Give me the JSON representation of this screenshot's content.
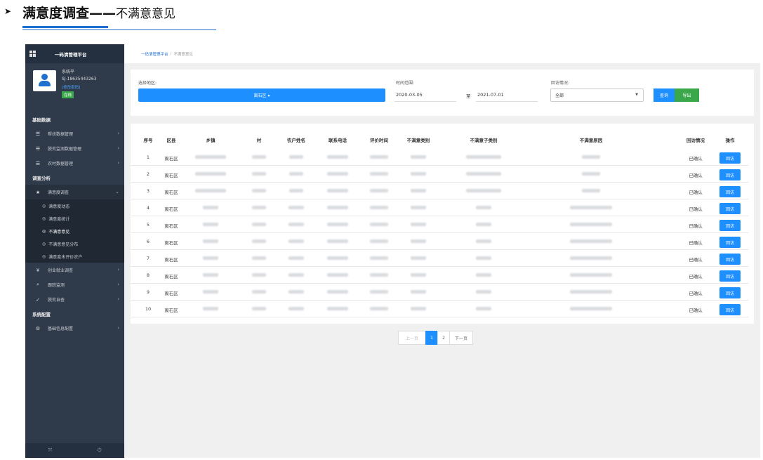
{
  "doc": {
    "title_bold": "满意度调查",
    "title_dash": "——",
    "title_rest": "不满意意见"
  },
  "sidebar": {
    "brand": "一码清管理平台",
    "user": {
      "name": "系统平",
      "phone": "SJ-18635443263",
      "change_pwd": "[修改密码]",
      "status": "在线"
    },
    "sections": {
      "basic": "基础数据",
      "analysis": "调查分析",
      "config": "系统配置"
    },
    "basic_items": [
      {
        "label": "帮扶数据管理",
        "icon": "list-icon"
      },
      {
        "label": "脱贫监测数据管理",
        "icon": "list-icon"
      },
      {
        "label": "农村数据管理",
        "icon": "list-icon"
      }
    ],
    "survey_item": {
      "label": "满意度调查",
      "icon": "star-icon"
    },
    "survey_sub": [
      "满意度动态",
      "满意度统计",
      "不满意意见",
      "不满意意见分布",
      "满意度未评价农户"
    ],
    "other_items": [
      {
        "label": "创业就业调查",
        "icon": "yen-icon"
      },
      {
        "label": "跟踪监测",
        "icon": "search-icon"
      },
      {
        "label": "脱贫自查",
        "icon": "thumbs-up-icon"
      }
    ],
    "config_items": [
      {
        "label": "基础信息配置",
        "icon": "gear-icon"
      }
    ]
  },
  "breadcrumb": {
    "home": "一码清管理平台",
    "sep": "/",
    "current": "不满意意见"
  },
  "filter": {
    "region_label": "选择地区:",
    "region_value": "离石区 ▾",
    "time_label": "时间范围:",
    "date_from": "2020-03-05",
    "date_sep": "至",
    "date_to": "2021-07-01",
    "visit_label": "回访情况:",
    "visit_value": "全部",
    "query_btn": "查询",
    "export_btn": "导出"
  },
  "table": {
    "headers": [
      "序号",
      "区县",
      "乡镇",
      "村",
      "农户姓名",
      "联系电话",
      "评价时间",
      "不满意类别",
      "不满意子类别",
      "不满意原因",
      "回访情况",
      "操作"
    ],
    "rows": [
      {
        "no": "1",
        "county": "离石区",
        "status": "已确认",
        "action": "回访"
      },
      {
        "no": "2",
        "county": "离石区",
        "status": "已确认",
        "action": "回访"
      },
      {
        "no": "3",
        "county": "离石区",
        "status": "已确认",
        "action": "回访"
      },
      {
        "no": "4",
        "county": "离石区",
        "status": "已确认",
        "action": "回访"
      },
      {
        "no": "5",
        "county": "离石区",
        "status": "已确认",
        "action": "回访"
      },
      {
        "no": "6",
        "county": "离石区",
        "status": "已确认",
        "action": "回访"
      },
      {
        "no": "7",
        "county": "离石区",
        "status": "已确认",
        "action": "回访"
      },
      {
        "no": "8",
        "county": "离石区",
        "status": "已确认",
        "action": "回访"
      },
      {
        "no": "9",
        "county": "离石区",
        "status": "已确认",
        "action": "回访"
      },
      {
        "no": "10",
        "county": "离石区",
        "status": "已确认",
        "action": "回访"
      }
    ]
  },
  "pager": {
    "prev": "上一页",
    "pages": [
      "1",
      "2"
    ],
    "current": "1",
    "next": "下一页"
  }
}
